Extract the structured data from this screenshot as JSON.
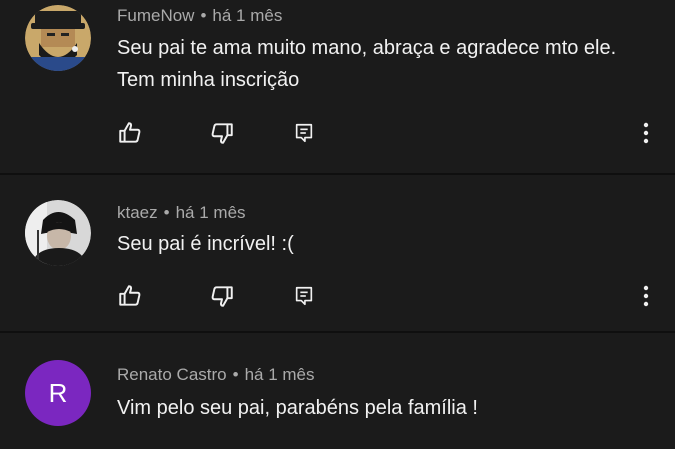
{
  "accent_colors": {
    "background": "#1b1b1b",
    "divider": "#0f0f0f",
    "text": "#f1f1f1",
    "meta": "#aaaaaa",
    "avatar_r": "#7b27c0"
  },
  "comments": [
    {
      "author": "FumeNow",
      "separator": "•",
      "time": "há 1 mês",
      "text": "Seu pai te ama muito mano, abraça e agradece mto ele. Tem minha inscrição",
      "avatar_type": "illustration"
    },
    {
      "author": "ktaez",
      "separator": "•",
      "time": "há 1 mês",
      "text": "Seu pai é incrível! :(",
      "avatar_type": "photo"
    },
    {
      "author": "Renato Castro",
      "separator": "•",
      "time": "há 1 mês",
      "text": "Vim pelo seu pai, parabéns pela família !",
      "avatar_type": "letter",
      "avatar_letter": "R"
    }
  ],
  "icons": {
    "like": "thumbs-up-icon",
    "dislike": "thumbs-down-icon",
    "reply": "reply-icon",
    "more": "more-vertical-icon"
  }
}
